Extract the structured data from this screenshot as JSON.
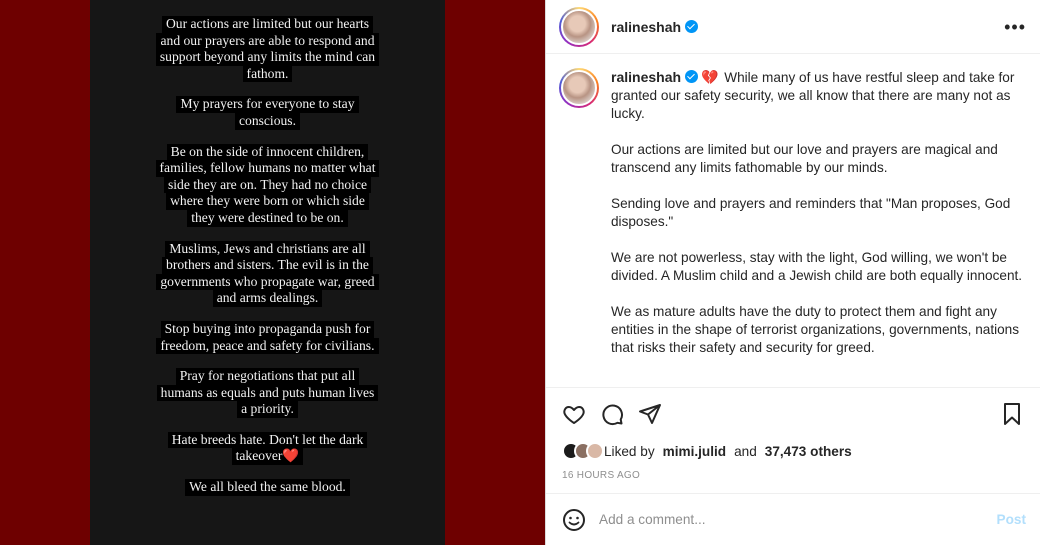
{
  "story": {
    "paragraphs": [
      [
        "Our actions are limited but our hearts",
        "and our prayers are able to respond and",
        "support beyond any limits the mind can",
        "fathom."
      ],
      [
        "My prayers for everyone to stay",
        "conscious."
      ],
      [
        "Be on the side of innocent children,",
        "families, fellow humans no matter what",
        "side they are on. They had no choice",
        "where they were born or which side",
        "they were destined to be on."
      ],
      [
        "Muslims, Jews and christians are all",
        "brothers and sisters. The evil is in the",
        "governments who propagate war, greed",
        "and arms dealings."
      ],
      [
        "Stop buying into propaganda push for",
        "freedom, peace and safety for civilians."
      ],
      [
        "Pray for negotiations that put all",
        "humans as equals and puts human lives",
        "a priority."
      ],
      [
        "Hate breeds hate. Don't let the dark",
        "takeover❤️"
      ],
      [
        "We all bleed the same blood."
      ]
    ]
  },
  "header": {
    "username": "ralineshah",
    "more_label": "•••"
  },
  "caption": {
    "username": "ralineshah",
    "emoji": "💔",
    "paragraphs": [
      "While many of us have restful sleep and take for granted our safety security, we all know that there are many not as lucky.",
      "Our actions are limited but our love and prayers are magical and transcend any limits fathomable by our minds.",
      "Sending love and prayers and reminders that \"Man proposes, God disposes.\"",
      "We are not powerless, stay with the light, God willing, we won't be divided. A Muslim child and a Jewish child are both equally innocent.",
      "We as mature adults have the duty to protect them and fight any entities in the shape of terrorist organizations, governments, nations that risks their safety and security for greed."
    ]
  },
  "likes": {
    "prefix": "Liked by",
    "user": "mimi.julid",
    "joiner": "and",
    "others": "37,473 others"
  },
  "timestamp": "16 HOURS AGO",
  "comment": {
    "placeholder": "Add a comment...",
    "post_label": "Post"
  },
  "colors": {
    "background_red": "#6e0000",
    "verified_blue": "#0095f6",
    "post_disabled": "#b2dffc"
  }
}
